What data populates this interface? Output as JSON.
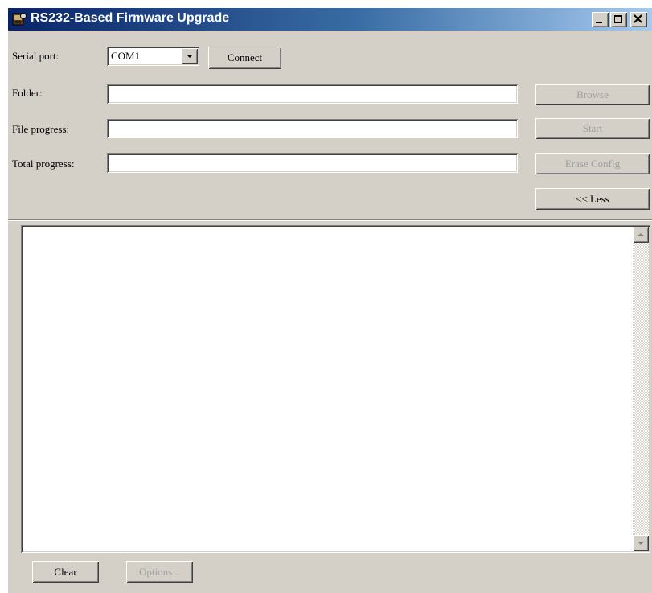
{
  "window": {
    "title": "RS232-Based Firmware Upgrade",
    "controls": [
      "minimize-icon",
      "maximize-icon",
      "close-icon"
    ]
  },
  "serial": {
    "label": "Serial port:",
    "selected": "COM1",
    "connect_label": "Connect"
  },
  "folder": {
    "label": "Folder:",
    "value": "",
    "browse_label": "Browse"
  },
  "file_progress": {
    "label": "File progress:",
    "value": "",
    "start_label": "Start"
  },
  "total_progress": {
    "label": "Total progress:",
    "value": "",
    "erase_label": "Erase Config"
  },
  "less_label": "<< Less",
  "log": {
    "text": ""
  },
  "footer": {
    "clear_label": "Clear",
    "options_label": "Options..."
  },
  "colors": {
    "face": "#d4d0c8",
    "title_start": "#0a246a",
    "title_end": "#a6caf0",
    "disabled_text": "#a0a0a0"
  }
}
